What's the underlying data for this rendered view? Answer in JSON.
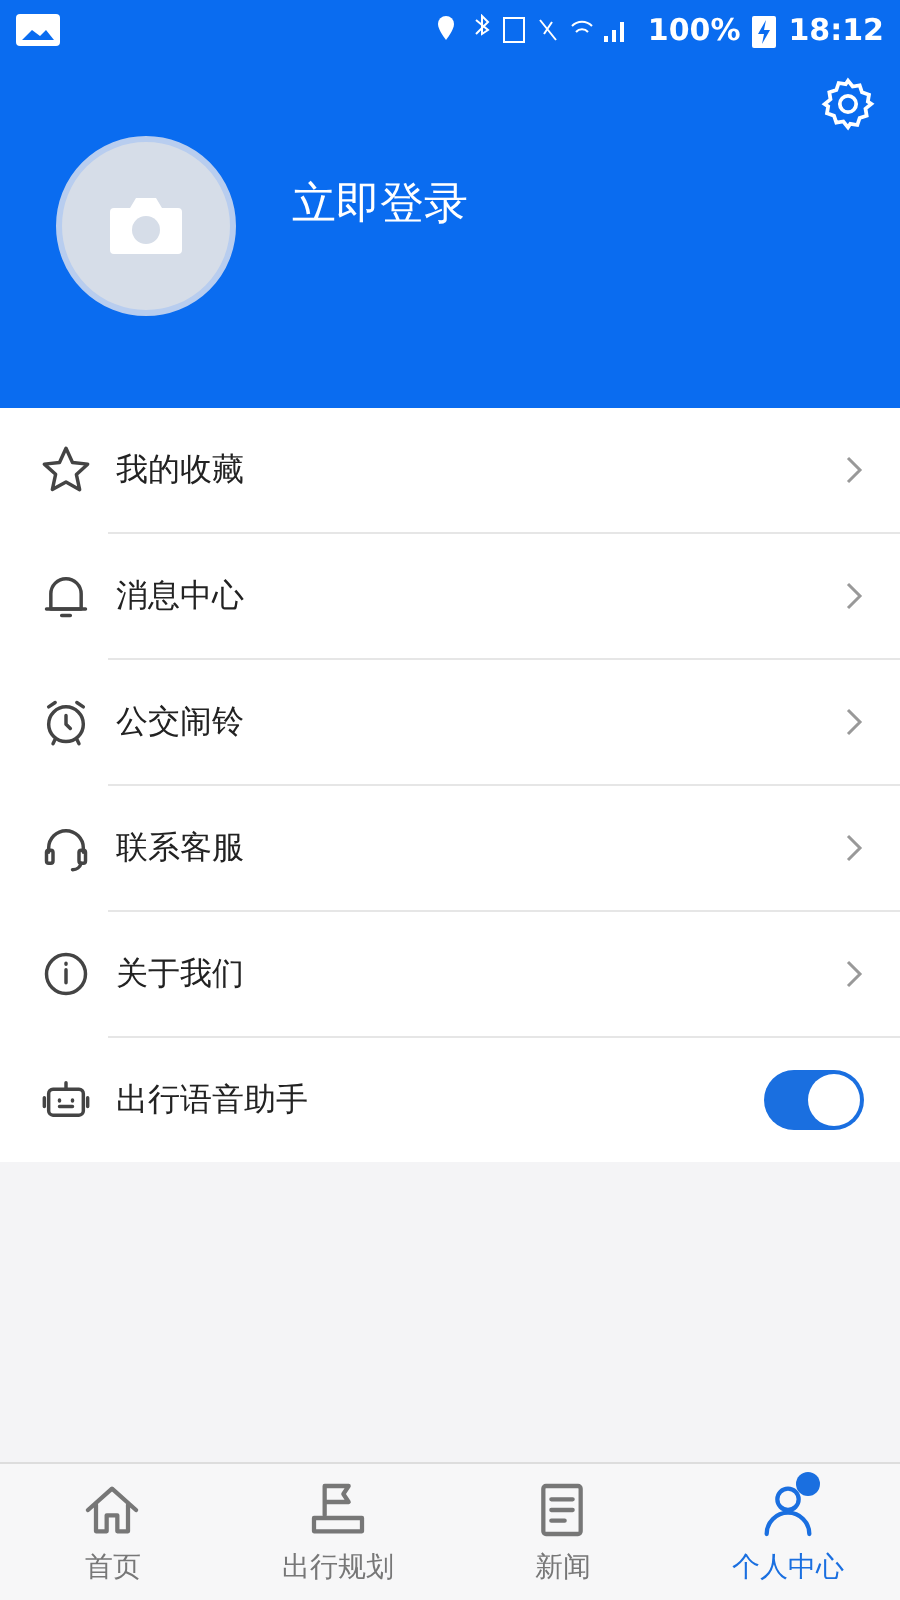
{
  "status_bar": {
    "battery": "100%",
    "time": "18:12"
  },
  "profile": {
    "login_label": "立即登录"
  },
  "menu": [
    {
      "kind": "link",
      "label": "我的收藏"
    },
    {
      "kind": "link",
      "label": "消息中心"
    },
    {
      "kind": "link",
      "label": "公交闹铃"
    },
    {
      "kind": "link",
      "label": "联系客服"
    },
    {
      "kind": "link",
      "label": "关于我们"
    },
    {
      "kind": "toggle",
      "label": "出行语音助手",
      "on": true
    }
  ],
  "tabs": [
    {
      "label": "首页",
      "selected": false,
      "badge": false
    },
    {
      "label": "出行规划",
      "selected": false,
      "badge": false
    },
    {
      "label": "新闻",
      "selected": false,
      "badge": false
    },
    {
      "label": "个人中心",
      "selected": true,
      "badge": true
    }
  ]
}
